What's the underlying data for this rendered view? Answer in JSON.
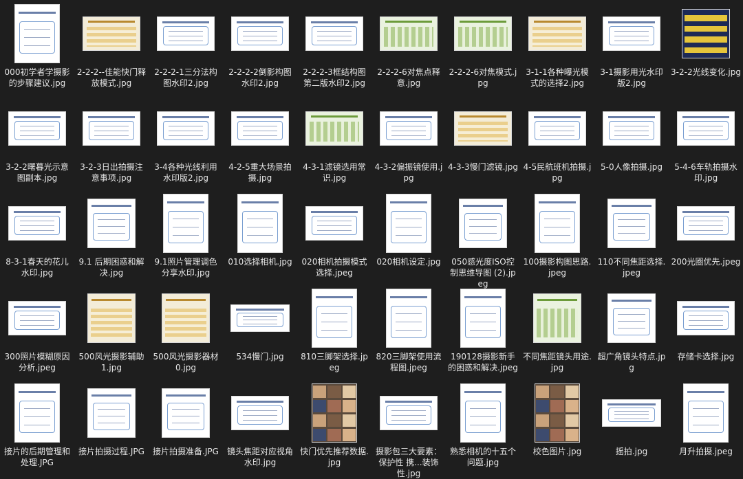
{
  "files": [
    {
      "name": "000初学者学摄影 的步骤建议.jpg",
      "shape": "t",
      "style": "plain"
    },
    {
      "name": "2-2-2--佳能快门释放模式.jpg",
      "shape": "w",
      "style": "cream"
    },
    {
      "name": "2-2-2-1三分法构图水印2.jpg",
      "shape": "w",
      "style": "plain"
    },
    {
      "name": "2-2-2-2倒影构图水印2.jpg",
      "shape": "w",
      "style": "plain"
    },
    {
      "name": "2-2-2-3框结构图第二版水印2.jpg",
      "shape": "w",
      "style": "plain"
    },
    {
      "name": "2-2-2-6对焦点释意.jpg",
      "shape": "w",
      "style": "green"
    },
    {
      "name": "2-2-2-6对焦模式.jpg",
      "shape": "w",
      "style": "green"
    },
    {
      "name": "3-1-1各种曝光模式的选择2.jpg",
      "shape": "w",
      "style": "cream"
    },
    {
      "name": "3-1摄影用光水印版2.jpg",
      "shape": "w",
      "style": "plain"
    },
    {
      "name": "3-2-2光线变化.jpg",
      "shape": "s",
      "style": "navy"
    },
    {
      "name": "3-2-2曙暮光示意图副本.jpg",
      "shape": "w",
      "style": "plain"
    },
    {
      "name": "3-2-3日出拍摄注意事项.jpg",
      "shape": "w",
      "style": "plain"
    },
    {
      "name": "3-4各种光线利用水印版2.jpg",
      "shape": "w",
      "style": "plain"
    },
    {
      "name": "4-2-5重大场景拍摄.jpg",
      "shape": "w",
      "style": "plain"
    },
    {
      "name": "4-3-1滤镜选用常识.jpg",
      "shape": "w",
      "style": "green"
    },
    {
      "name": "4-3-2偏振镜使用.jpg",
      "shape": "w",
      "style": "plain"
    },
    {
      "name": "4-3-3慢门滤镜.jpg",
      "shape": "w",
      "style": "cream"
    },
    {
      "name": "4-5民航班机拍摄.jpg",
      "shape": "w",
      "style": "plain"
    },
    {
      "name": "5-0人像拍摄.jpg",
      "shape": "w",
      "style": "plain"
    },
    {
      "name": "5-4-6车轨拍摄水印.jpg",
      "shape": "w",
      "style": "plain"
    },
    {
      "name": "8-3-1春天的花儿水印.jpg",
      "shape": "w",
      "style": "plain"
    },
    {
      "name": "9.1 后期困惑和解决.jpg",
      "shape": "s",
      "style": "plain"
    },
    {
      "name": "9.1照片管理调色分享水印.jpg",
      "shape": "t",
      "style": "plain"
    },
    {
      "name": "010选择相机.jpg",
      "shape": "t",
      "style": "plain"
    },
    {
      "name": "020相机拍摄模式选择.jpeg",
      "shape": "w",
      "style": "plain"
    },
    {
      "name": "020相机设定.jpg",
      "shape": "t",
      "style": "plain"
    },
    {
      "name": "050感光度ISO控制思维导图 (2).jpeg",
      "shape": "s",
      "style": "plain"
    },
    {
      "name": "100摄影构图思路.jpeg",
      "shape": "t",
      "style": "plain"
    },
    {
      "name": "110不同焦距选择.jpeg",
      "shape": "s",
      "style": "plain"
    },
    {
      "name": "200光圈优先.jpeg",
      "shape": "w",
      "style": "plain"
    },
    {
      "name": "300照片模糊原因分析.jpeg",
      "shape": "w",
      "style": "plain"
    },
    {
      "name": "500风光摄影辅助1.jpg",
      "shape": "s",
      "style": "cream"
    },
    {
      "name": "500风光摄影器材0.jpg",
      "shape": "s",
      "style": "cream"
    },
    {
      "name": "534慢门.jpg",
      "shape": "ww",
      "style": "plain"
    },
    {
      "name": "810三脚架选择.jpeg",
      "shape": "t",
      "style": "plain"
    },
    {
      "name": "820三脚架使用流程图.jpeg",
      "shape": "t",
      "style": "plain"
    },
    {
      "name": "190128摄影新手的困惑和解决.jpeg",
      "shape": "t",
      "style": "plain"
    },
    {
      "name": "不同焦距镜头用途.jpg",
      "shape": "s",
      "style": "green"
    },
    {
      "name": "超广角镜头特点.jpg",
      "shape": "s",
      "style": "plain"
    },
    {
      "name": "存储卡选择.jpg",
      "shape": "w",
      "style": "plain"
    },
    {
      "name": "接片的后期管理和处理.JPG",
      "shape": "t",
      "style": "plain"
    },
    {
      "name": "接片拍摄过程.JPG",
      "shape": "s",
      "style": "plain"
    },
    {
      "name": "接片拍摄准备.JPG",
      "shape": "s",
      "style": "plain"
    },
    {
      "name": "镜头焦距对应视角水印.jpg",
      "shape": "w",
      "style": "plain"
    },
    {
      "name": "快门优先推荐数据.jpg",
      "shape": "t",
      "style": "photo"
    },
    {
      "name": "摄影包三大要素：保护性 携...装饰性.jpg",
      "shape": "w",
      "style": "plain"
    },
    {
      "name": "熟悉相机的十五个问题.jpg",
      "shape": "t",
      "style": "plain"
    },
    {
      "name": "校色图片.jpg",
      "shape": "t",
      "style": "photo"
    },
    {
      "name": "摇拍.jpg",
      "shape": "ww",
      "style": "plain"
    },
    {
      "name": "月升拍摄.jpeg",
      "shape": "t",
      "style": "plain"
    }
  ]
}
